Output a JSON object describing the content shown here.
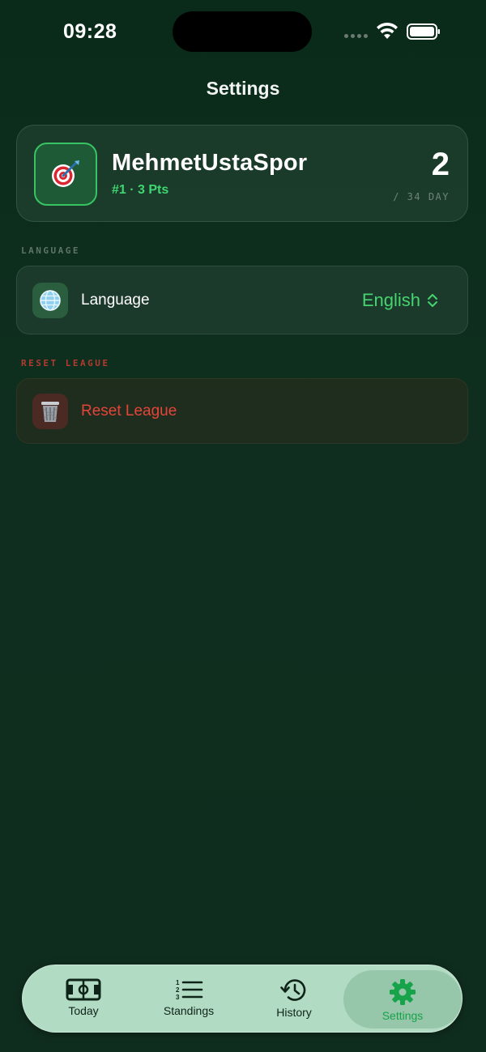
{
  "status": {
    "time": "09:28"
  },
  "header": {
    "title": "Settings"
  },
  "profile": {
    "team_name": "MehmetUstaSpor",
    "stats": "#1 · 3 Pts",
    "day_current": "2",
    "day_total": "/ 34 DAY",
    "avatar_icon": "dart-target-icon"
  },
  "language_section": {
    "header": "LANGUAGE",
    "row_label": "Language",
    "selected_value": "English",
    "icon": "globe-icon"
  },
  "reset_section": {
    "header": "RESET LEAGUE",
    "row_label": "Reset League",
    "icon": "trash-icon"
  },
  "tabs": [
    {
      "label": "Today",
      "icon": "pitch-icon",
      "active": false
    },
    {
      "label": "Standings",
      "icon": "numbered-list-icon",
      "active": false
    },
    {
      "label": "History",
      "icon": "history-clock-icon",
      "active": false
    },
    {
      "label": "Settings",
      "icon": "gear-icon",
      "active": true
    }
  ],
  "colors": {
    "accent": "#45d46f",
    "danger": "#e5443a",
    "tab_active": "#16a34a",
    "background": "#0f2e1f"
  }
}
